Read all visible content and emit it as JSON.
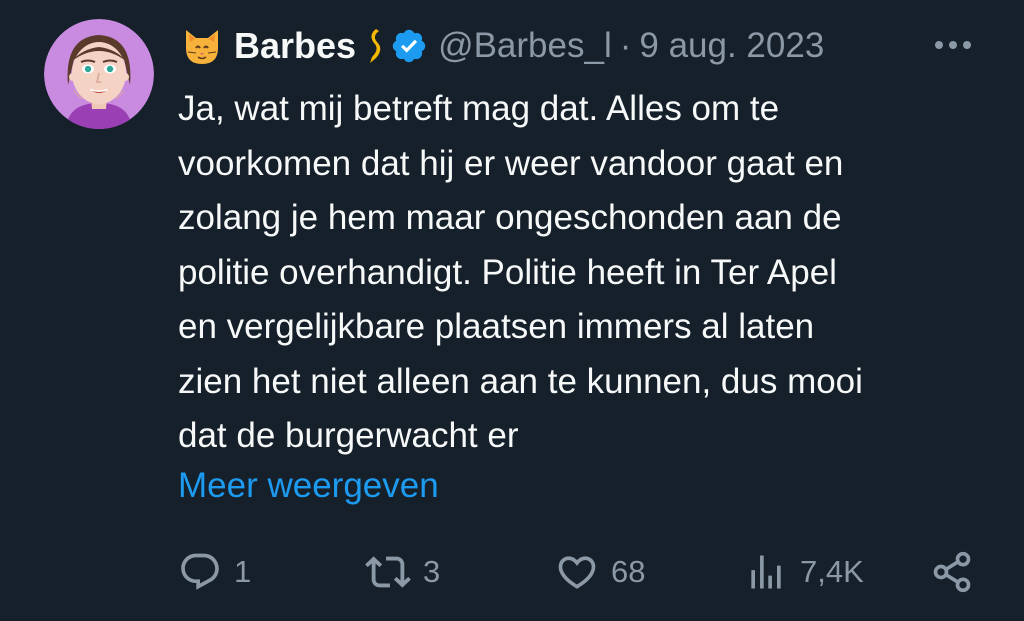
{
  "tweet": {
    "author": {
      "display_name": "Barbes",
      "handle": "@Barbes_l",
      "name_emoji": "cat-face-icon",
      "flag_icon": "yellow-ribbon-icon",
      "verified_icon": "verified-badge-icon"
    },
    "separator": "·",
    "date": "9 aug. 2023",
    "more_icon": "more-dots-icon",
    "text_lines": [
      "Ja, wat mij betreft mag dat. Alles om te",
      "voorkomen dat hij er weer vandoor gaat en",
      "zolang je hem maar ongeschonden aan de",
      "politie overhandigt. Politie heeft in Ter Apel",
      "en vergelijkbare plaatsen immers al laten",
      "zien het niet alleen aan te kunnen, dus mooi",
      "dat de burgerwacht er"
    ],
    "show_more": "Meer weergeven",
    "actions": {
      "reply": {
        "icon": "reply-bubble-icon",
        "count": "1"
      },
      "retweet": {
        "icon": "retweet-icon",
        "count": "3"
      },
      "like": {
        "icon": "heart-icon",
        "count": "68"
      },
      "views": {
        "icon": "views-bar-chart-icon",
        "count": "7,4K"
      },
      "share": {
        "icon": "share-icon"
      }
    }
  },
  "colors": {
    "background": "#15202b",
    "text_primary": "#f7f9f9",
    "text_secondary": "#8b98a5",
    "link": "#1d9bf0",
    "verified": "#1d9bf0"
  }
}
